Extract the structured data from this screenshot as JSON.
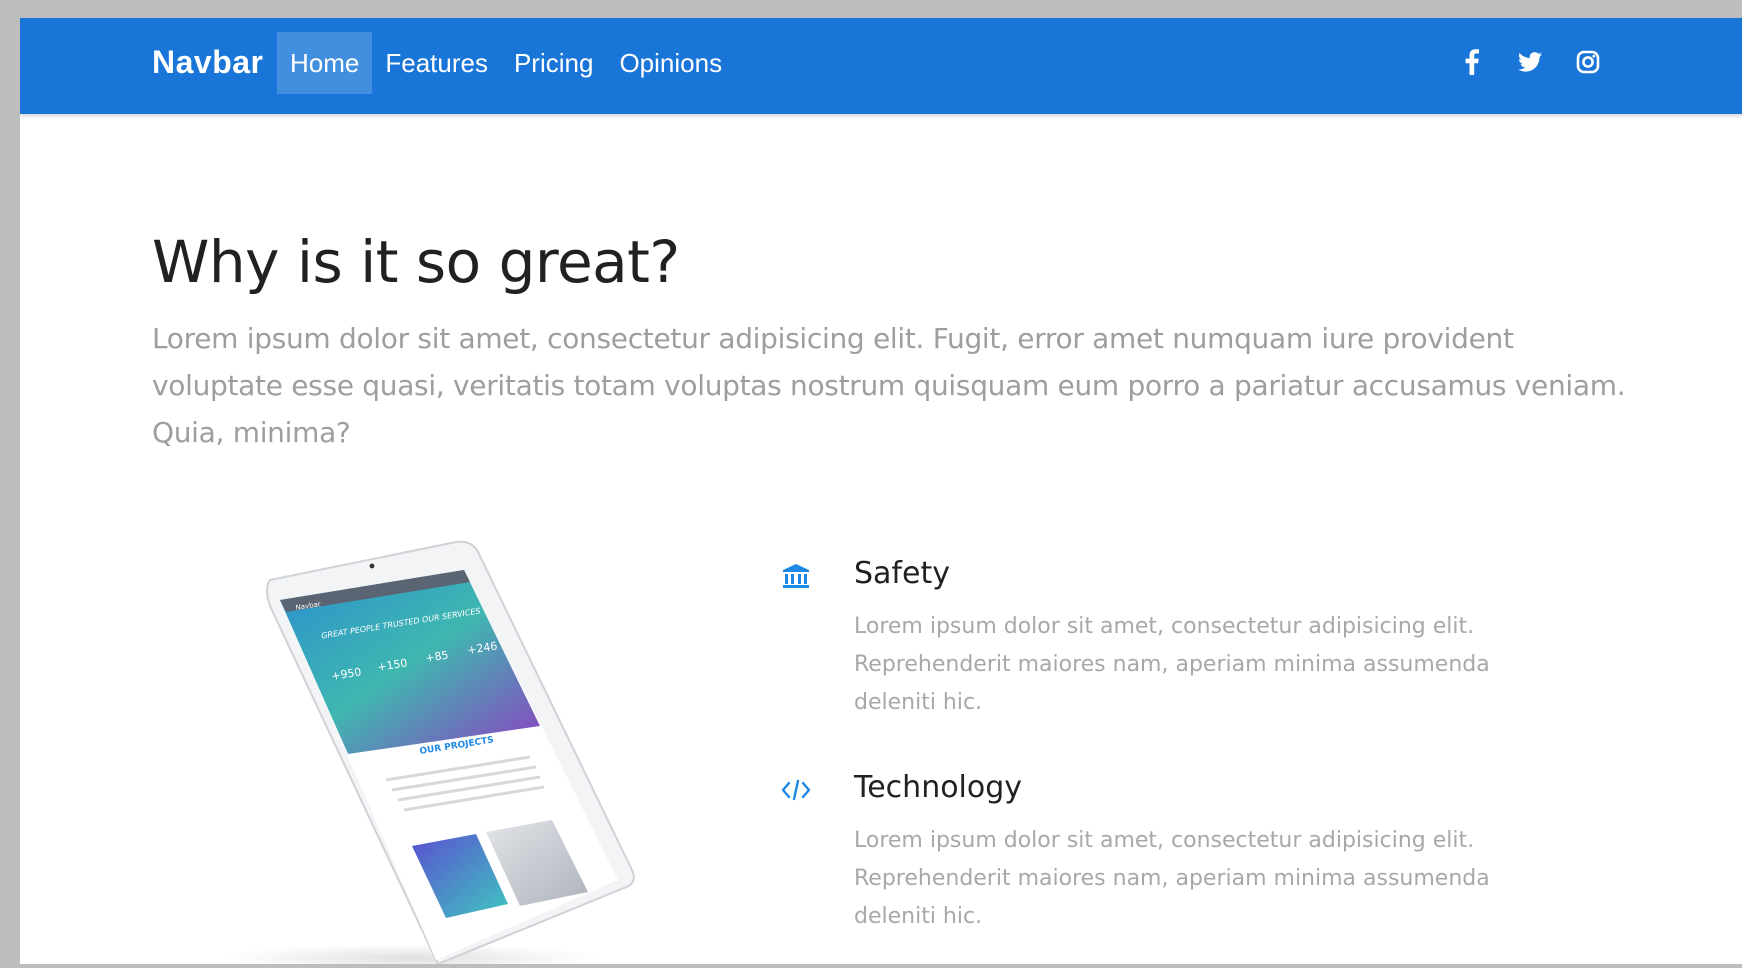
{
  "navbar": {
    "brand": "Navbar",
    "links": [
      {
        "label": "Home",
        "active": true
      },
      {
        "label": "Features",
        "active": false
      },
      {
        "label": "Pricing",
        "active": false
      },
      {
        "label": "Opinions",
        "active": false
      }
    ],
    "social": [
      "facebook-icon",
      "twitter-icon",
      "instagram-icon"
    ]
  },
  "section": {
    "heading": "Why is it so great?",
    "lead": "Lorem ipsum dolor sit amet, consectetur adipisicing elit. Fugit, error amet numquam iure provident voluptate esse quasi, veritatis totam voluptas nostrum quisquam eum porro a pariatur accusamus veniam. Quia, minima?"
  },
  "tablet": {
    "nav_label": "Navbar",
    "hero_text": "GREAT PEOPLE TRUSTED OUR SERVICES",
    "stats": [
      "+950",
      "+150",
      "+85",
      "+246"
    ],
    "projects_title": "OUR PROJECTS"
  },
  "features": [
    {
      "icon": "bank-icon",
      "title": "Safety",
      "text": "Lorem ipsum dolor sit amet, consectetur adipisicing elit. Reprehenderit maiores nam, aperiam minima assumenda deleniti hic."
    },
    {
      "icon": "code-icon",
      "title": "Technology",
      "text": "Lorem ipsum dolor sit amet, consectetur adipisicing elit. Reprehenderit maiores nam, aperiam minima assumenda deleniti hic."
    }
  ],
  "colors": {
    "primary": "#1976d8",
    "heading": "#212121",
    "muted": "#9e9e9e",
    "icon_blue": "#1e88e5"
  }
}
